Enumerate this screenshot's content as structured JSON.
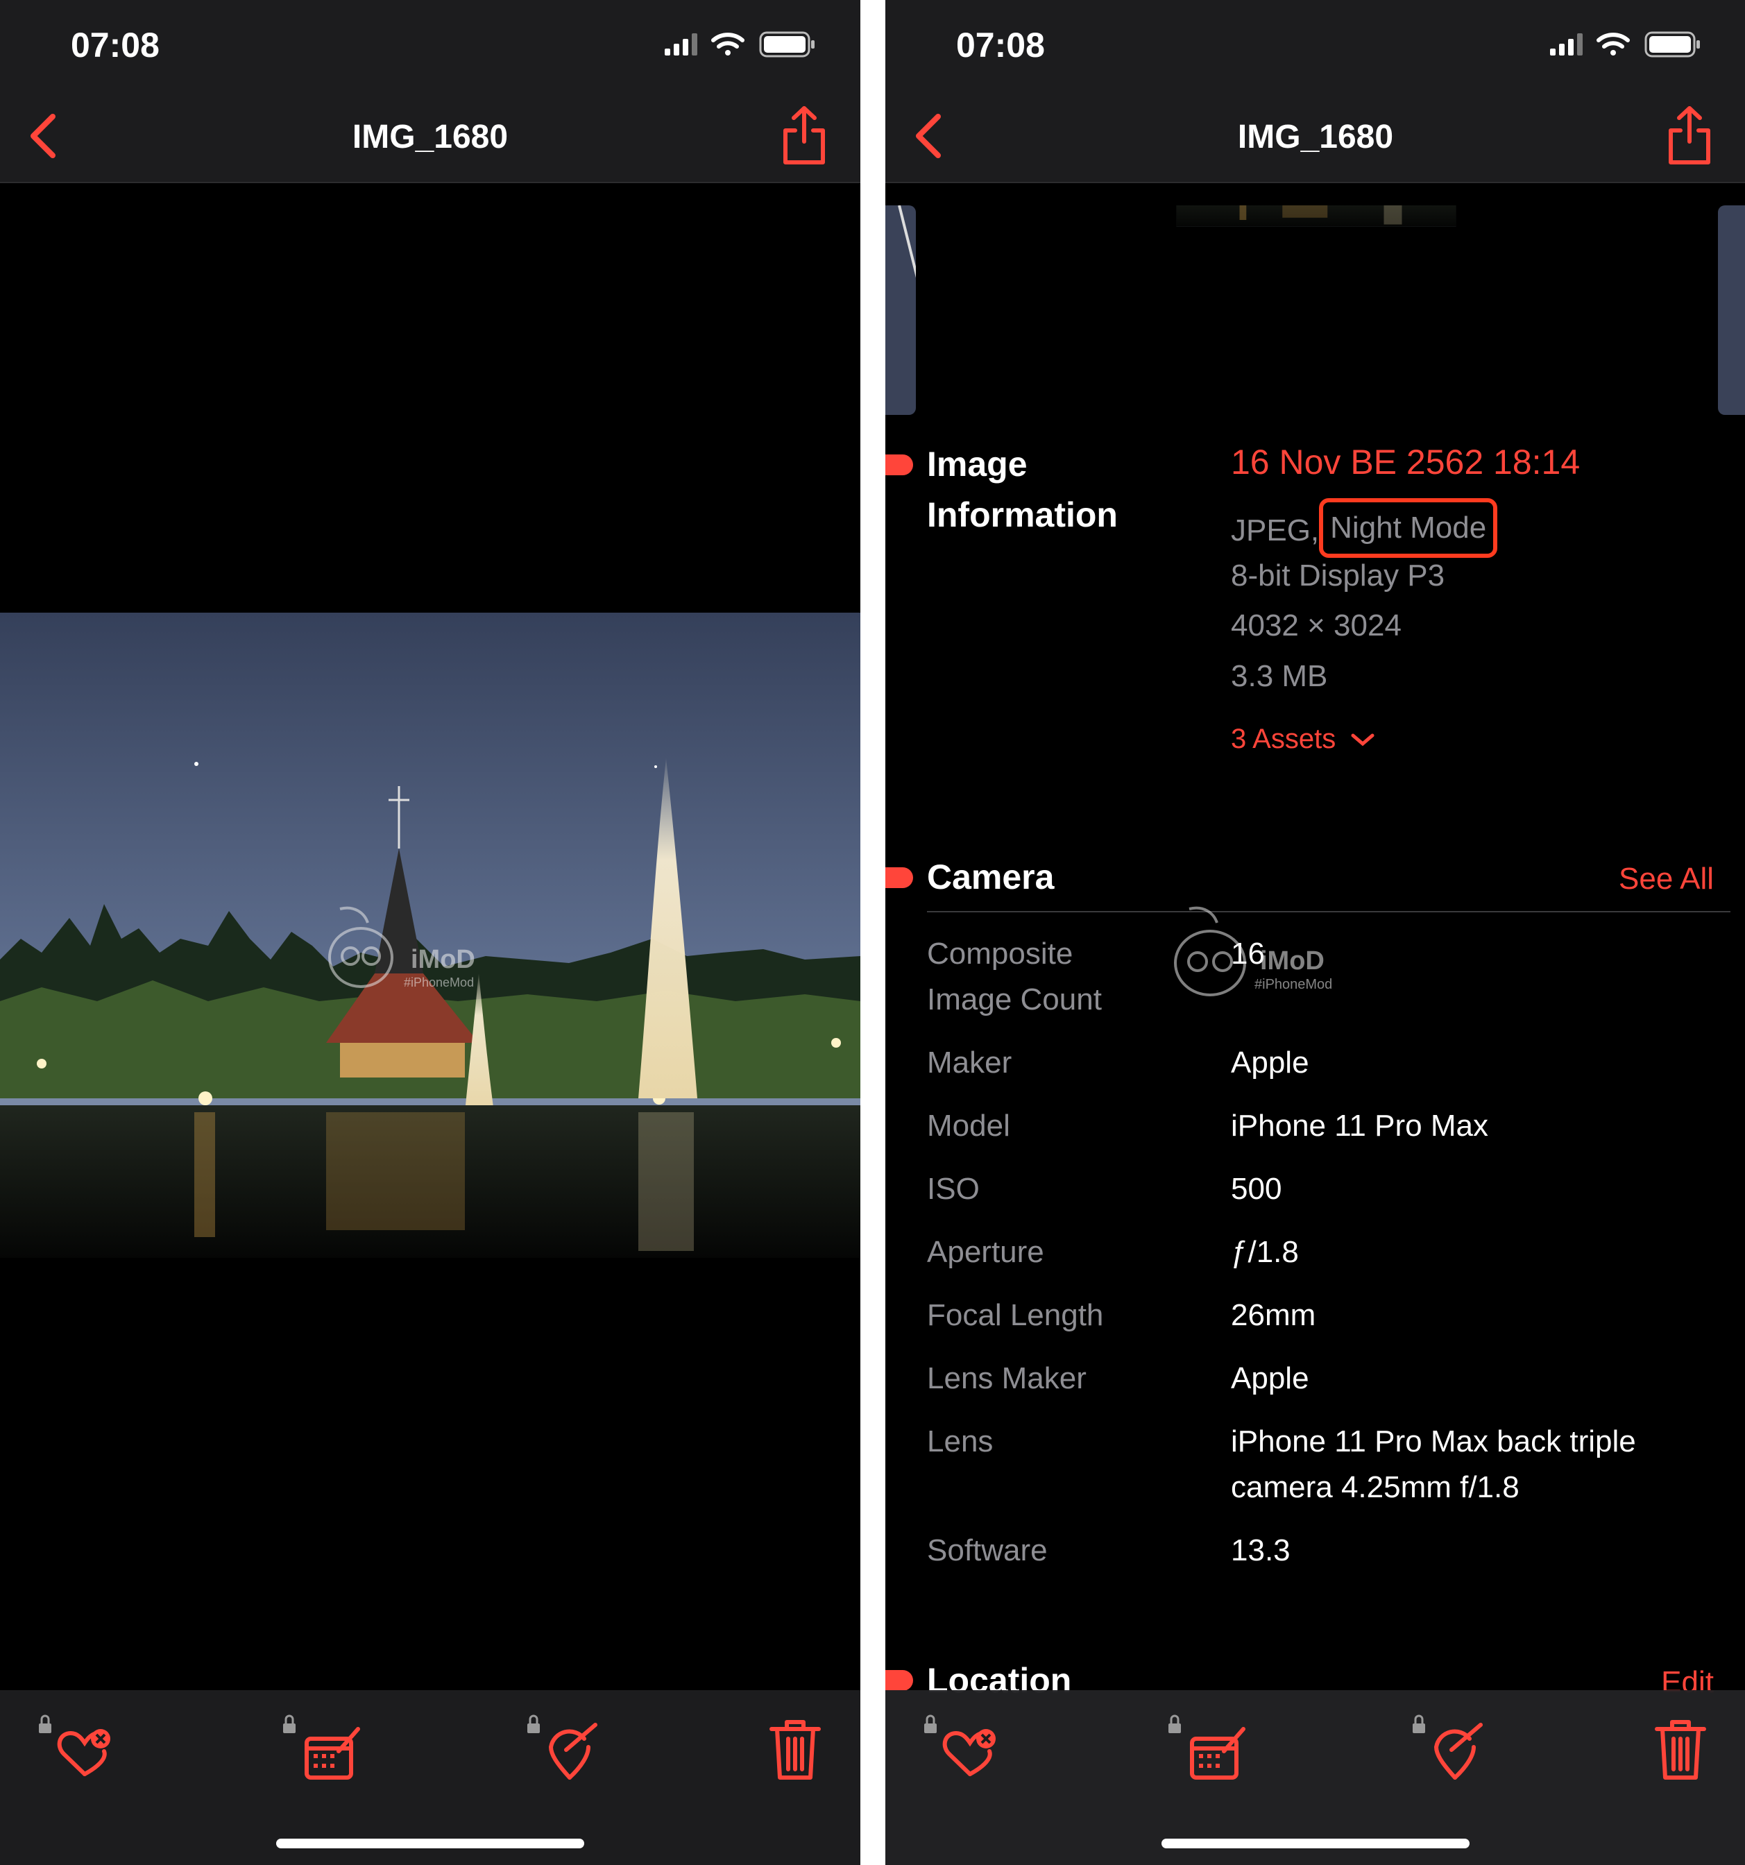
{
  "status_bar": {
    "time": "07:08"
  },
  "nav": {
    "title": "IMG_1680"
  },
  "image_information": {
    "heading_line1": "Image",
    "heading_line2": "Information",
    "date": "16 Nov BE 2562 18:14",
    "format": "JPEG,",
    "mode": "Night Mode",
    "color_profile": "8-bit Display P3",
    "dimensions": "4032 × 3024",
    "file_size": "3.3 MB",
    "assets_label": "3 Assets"
  },
  "camera": {
    "heading": "Camera",
    "see_all": "See All",
    "rows": [
      {
        "label_line1": "Composite",
        "label_line2": "Image Count",
        "value": "16"
      },
      {
        "label": "Maker",
        "value": "Apple"
      },
      {
        "label": "Model",
        "value": "iPhone 11 Pro Max"
      },
      {
        "label": "ISO",
        "value": "500"
      },
      {
        "label": "Aperture",
        "value": "ƒ/1.8"
      },
      {
        "label": "Focal Length",
        "value": "26mm"
      },
      {
        "label": "Lens Maker",
        "value": "Apple"
      },
      {
        "label": "Lens",
        "value_line1": "iPhone 11 Pro Max back triple",
        "value_line2": "camera 4.25mm f/1.8"
      },
      {
        "label": "Software",
        "value": "13.3"
      }
    ]
  },
  "location": {
    "heading": "Location",
    "edit": "Edit"
  },
  "watermark": {
    "brand": "iMoD",
    "tag": "#iPhoneMod"
  },
  "colors": {
    "accent": "#ff453a",
    "bar_bg": "#1c1c1e",
    "secondary_text": "#8e8e93"
  },
  "toolbar_icons": [
    "heart-remove-icon",
    "calendar-edit-icon",
    "location-edit-icon",
    "trash-icon"
  ]
}
